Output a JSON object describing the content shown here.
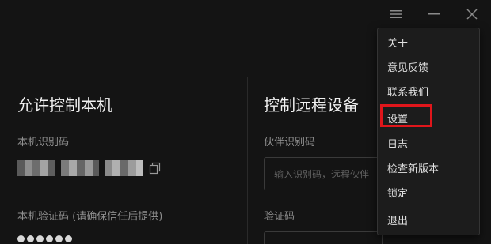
{
  "colors": {
    "accent": "#2f6fed",
    "highlight": "#e0161b",
    "background": "#141414",
    "menu_background": "#1c1c1c"
  },
  "titlebar": {
    "icons": [
      "menu-icon",
      "minimize-icon",
      "close-icon"
    ]
  },
  "left_panel": {
    "title": "允许控制本机",
    "device_id_label": "本机识别码",
    "device_id_masked": true,
    "verify_code_label": "本机验证码 (请确保信任后提供)",
    "verify_code_masked": true
  },
  "right_panel": {
    "title": "控制远程设备",
    "partner_id_label": "伙伴识别码",
    "partner_id_placeholder": "输入识别码，远程伙伴",
    "verify_code_label": "验证码"
  },
  "menu": {
    "items": [
      {
        "label": "关于"
      },
      {
        "label": "意见反馈"
      },
      {
        "label": "联系我们"
      },
      {
        "label": "设置",
        "highlighted": true
      },
      {
        "label": "日志"
      },
      {
        "label": "检查新版本"
      },
      {
        "label": "锁定"
      },
      {
        "label": "退出"
      }
    ]
  }
}
